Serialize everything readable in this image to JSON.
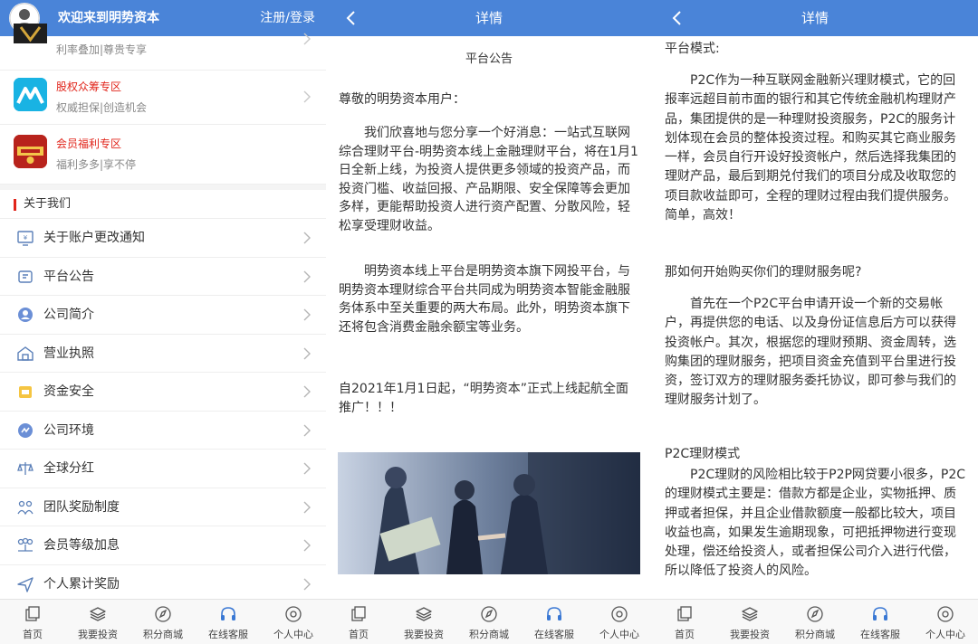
{
  "screen1": {
    "header": {
      "welcome": "欢迎来到明势资本",
      "login": "注册/登录"
    },
    "promos": [
      {
        "name": "",
        "sub": "利率叠加|尊贵专享",
        "icon": "vip-badge-icon"
      },
      {
        "name": "股权众筹专区",
        "sub": "权威担保|创造机会",
        "icon": "crowdfunding-icon"
      },
      {
        "name": "会员福利专区",
        "sub": "福利多多|享不停",
        "icon": "member-welfare-icon"
      }
    ],
    "section_title": "关于我们",
    "menu": [
      {
        "label": "关于账户更改通知",
        "icon": "notice-icon"
      },
      {
        "label": "平台公告",
        "icon": "announcement-icon"
      },
      {
        "label": "公司简介",
        "icon": "company-profile-icon"
      },
      {
        "label": "营业执照",
        "icon": "license-icon"
      },
      {
        "label": "资金安全",
        "icon": "fund-safety-icon"
      },
      {
        "label": "公司环境",
        "icon": "environment-icon"
      },
      {
        "label": "全球分红",
        "icon": "dividend-icon"
      },
      {
        "label": "团队奖励制度",
        "icon": "team-reward-icon"
      },
      {
        "label": "会员等级加息",
        "icon": "member-level-icon"
      },
      {
        "label": "个人累计奖励",
        "icon": "personal-reward-icon"
      }
    ]
  },
  "tabs": [
    {
      "label": "首页",
      "icon": "home-icon"
    },
    {
      "label": "我要投资",
      "icon": "invest-icon"
    },
    {
      "label": "积分商城",
      "icon": "points-mall-icon"
    },
    {
      "label": "在线客服",
      "icon": "customer-service-icon"
    },
    {
      "label": "个人中心",
      "icon": "user-center-icon"
    }
  ],
  "screen2": {
    "header_title": "详情",
    "article_title": "平台公告",
    "greeting": "尊敬的明势资本用户：",
    "para1": "　　我们欣喜地与您分享一个好消息：一站式互联网综合理财平台-明势资本线上金融理财平台，将在1月1日全新上线，为投资人提供更多领域的投资产品，而投资门槛、收益回报、产品期限、安全保障等会更加多样，更能帮助投资人进行资产配置、分散风险，轻松享受理财收益。",
    "para2": "　　明势资本线上平台是明势资本旗下网投平台，与明势资本理财综合平台共同成为明势资本智能金融服务体系中至关重要的两大布局。此外，明势资本旗下还将包含消费金融余额宝等业务。",
    "para3": "自2021年1月1日起，“明势资本”正式上线起航全面推广！！！"
  },
  "screen3": {
    "header_title": "详情",
    "h1": "平台模式:",
    "p1": "　　P2C作为一种互联网金融新兴理财模式，它的回报率远超目前市面的银行和其它传统金融机构理财产品，集团提供的是一种理财投资服务，P2C的服务计划体现在会员的整体投资过程。和购买其它商业服务一样，会员自行开设好投资帐户，然后选择我集团的理财产品，最后到期兑付我们的项目分成及收取您的项目款收益即可，全程的理财过程由我们提供服务。简单，高效！",
    "q": "那如何开始购买你们的理财服务呢?",
    "p2": "　　首先在一个P2C平台申请开设一个新的交易帐户，再提供您的电话、以及身份证信息后方可以获得投资帐户。其次，根据您的理财预期、资金周转，选购集团的理财服务，把项目资金充值到平台里进行投资，签订双方的理财服务委托协议，即可参与我们的理财服务计划了。",
    "h2": "P2C理财模式",
    "p3": "　　P2C理财的风险相比较于P2P网贷要小很多，P2C的理财模式主要是：借款方都是企业，实物抵押、质押或者担保，并且企业借款额度一般都比较大，项目收益也高，如果发生逾期现象，可把抵押物进行变现处理，偿还给投资人，或者担保公司介入进行代偿，所以降低了投资人的风险。"
  },
  "colors": {
    "header": "#4a84d8",
    "accent_red": "#e1251b",
    "tab_bg": "#f8f8f8"
  }
}
